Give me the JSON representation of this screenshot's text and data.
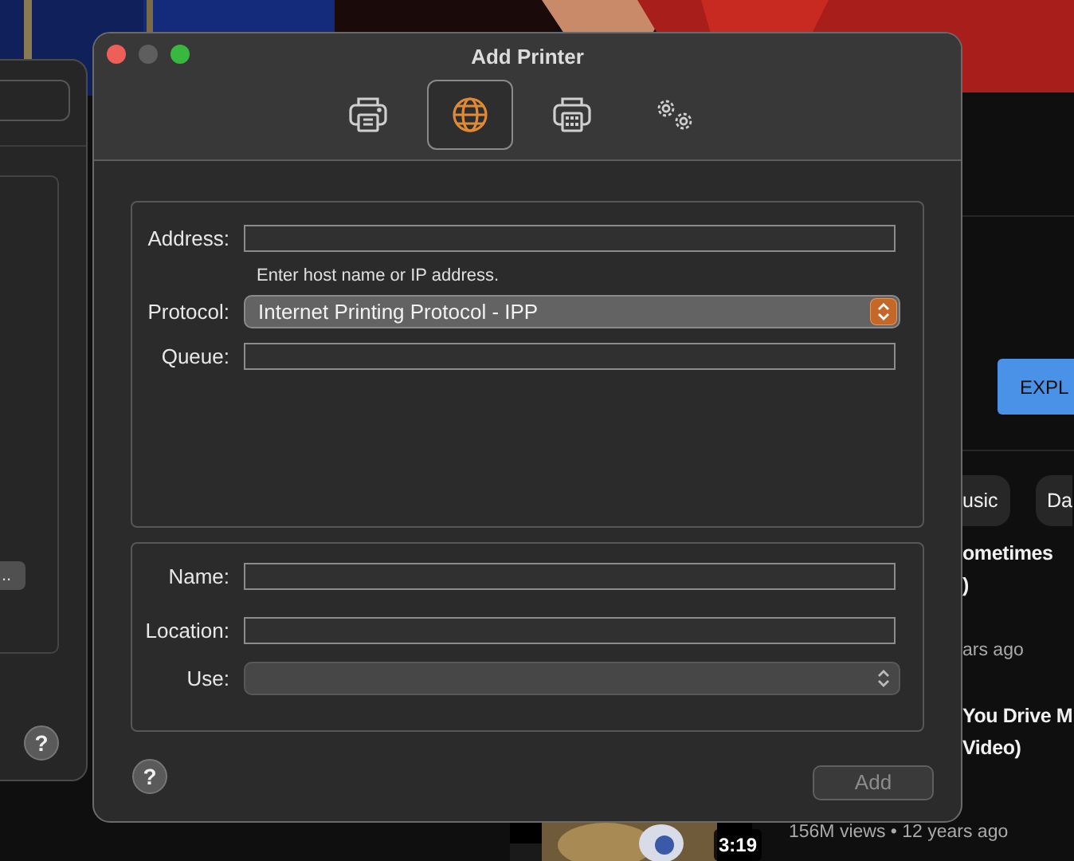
{
  "window": {
    "title": "Add Printer"
  },
  "toolbar": [
    {
      "kind": "printer",
      "selected": false
    },
    {
      "kind": "globe",
      "selected": true
    },
    {
      "kind": "fax",
      "selected": false
    },
    {
      "kind": "gears",
      "selected": false
    }
  ],
  "connection": {
    "address": {
      "label": "Address:"
    },
    "hint": "Enter host name or IP address.",
    "protocol": {
      "label": "Protocol:",
      "value": "Internet Printing Protocol - IPP"
    },
    "queue": {
      "label": "Queue:"
    }
  },
  "details": {
    "name": {
      "label": "Name:"
    },
    "location": {
      "label": "Location:"
    },
    "use": {
      "label": "Use:"
    }
  },
  "help_button": "?",
  "add_button": {
    "label": "Add",
    "disabled": true
  },
  "back_window": {
    "button": "..",
    "help_button": "?"
  },
  "video_site": {
    "explore_button": "EXPL",
    "chips": [
      "usic",
      "Da"
    ],
    "videos": [
      {
        "title_lines": [
          "ometimes",
          ")"
        ],
        "meta": "ars ago"
      },
      {
        "title_lines": [
          "You Drive M",
          "Video)"
        ],
        "meta": "156M views • 12 years ago",
        "duration": "3:19"
      }
    ]
  }
}
